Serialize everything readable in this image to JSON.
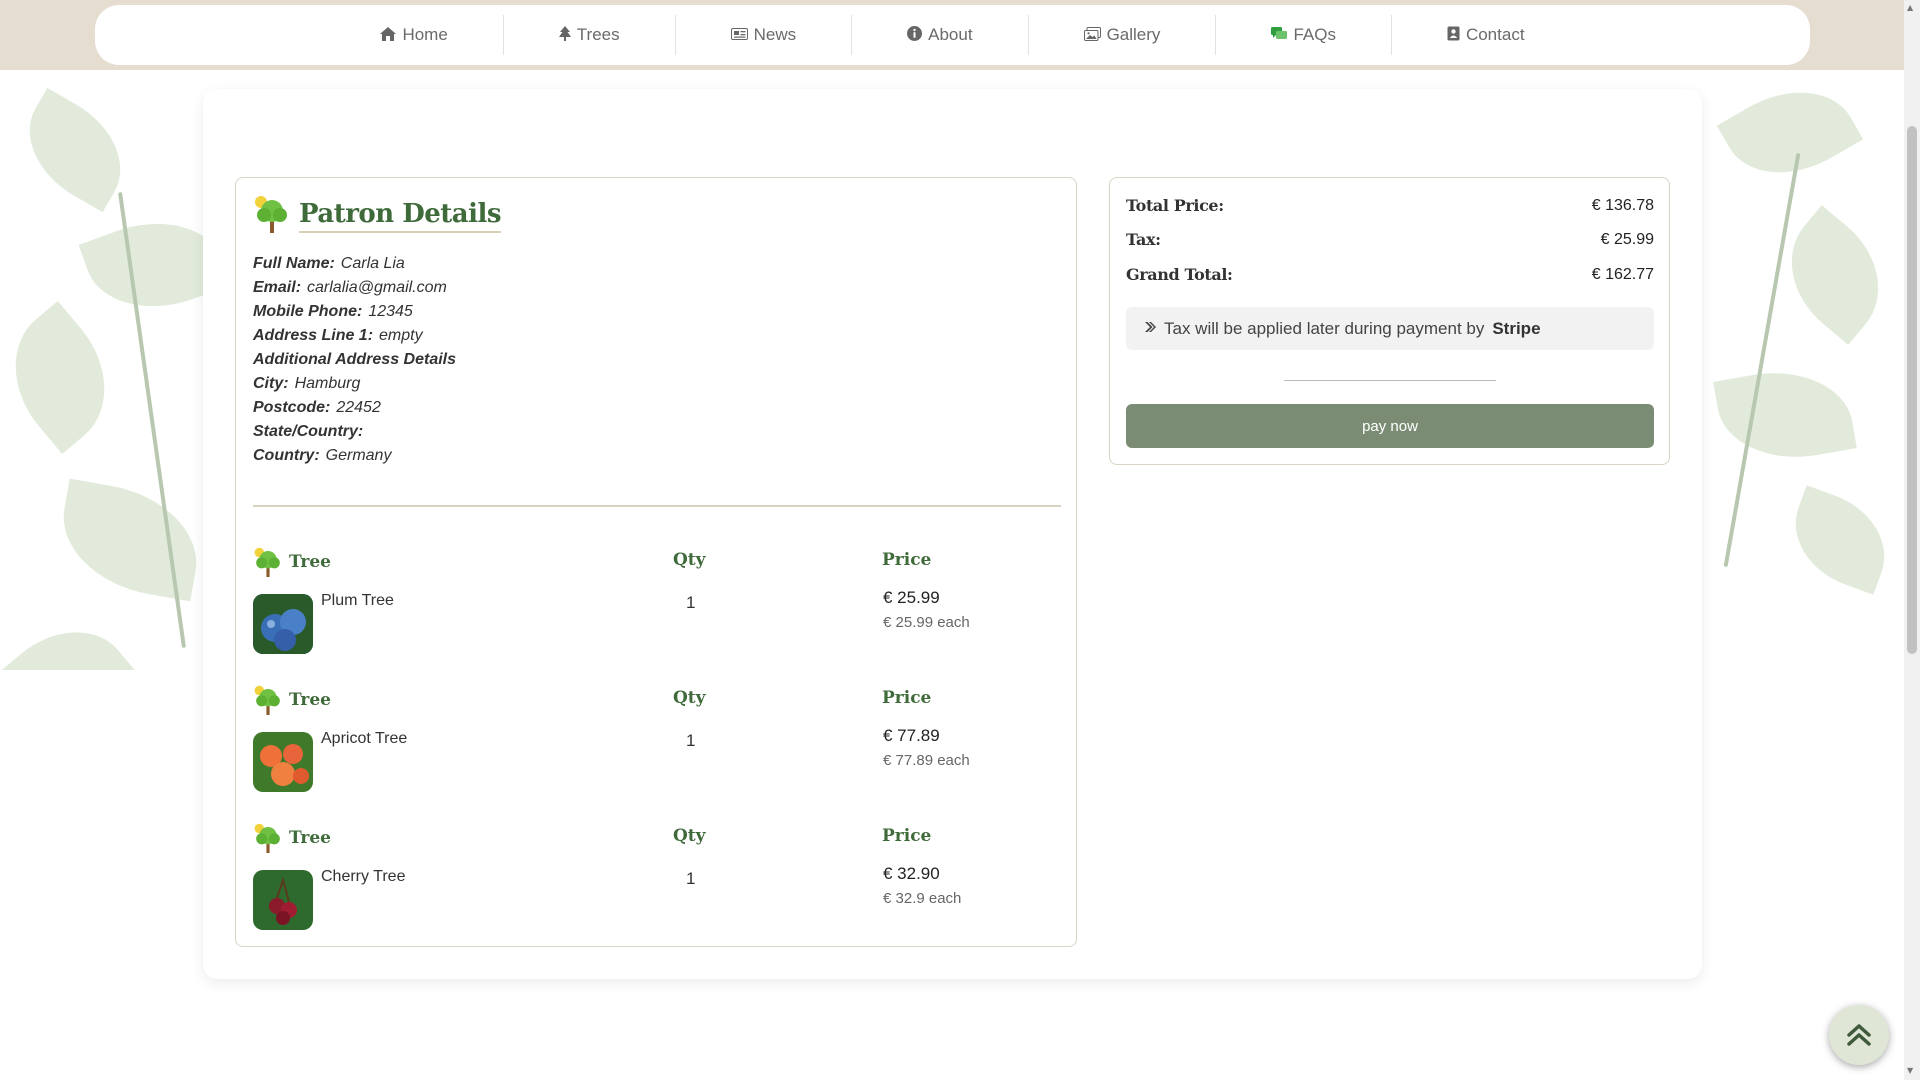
{
  "nav": {
    "items": [
      {
        "label": "Home",
        "icon": "home-icon"
      },
      {
        "label": "Trees",
        "icon": "tree-icon"
      },
      {
        "label": "News",
        "icon": "newspaper-icon"
      },
      {
        "label": "About",
        "icon": "info-icon"
      },
      {
        "label": "Gallery",
        "icon": "image-icon"
      },
      {
        "label": "FAQs",
        "icon": "chat-icon"
      },
      {
        "label": "Contact",
        "icon": "contact-card-icon"
      }
    ]
  },
  "patron": {
    "title": "Patron Details",
    "fields": [
      {
        "label": "Full Name:",
        "value": "Carla Lia"
      },
      {
        "label": "Email:",
        "value": "carlalia@gmail.com"
      },
      {
        "label": "Mobile Phone:",
        "value": "12345"
      },
      {
        "label": "Address Line 1:",
        "value": "empty"
      },
      {
        "label": "Additional Address Details",
        "value": ""
      },
      {
        "label": "City:",
        "value": "Hamburg"
      },
      {
        "label": "Postcode:",
        "value": "22452"
      },
      {
        "label": "State/Country:",
        "value": ""
      },
      {
        "label": "Country:",
        "value": "Germany"
      }
    ]
  },
  "items_header": {
    "tree": "Tree",
    "qty": "Qty",
    "price": "Price"
  },
  "items": [
    {
      "name": "Plum Tree",
      "qty": "1",
      "price": "€ 25.99",
      "each": "€ 25.99 each",
      "thumb_color": "#3a6fb8"
    },
    {
      "name": "Apricot Tree",
      "qty": "1",
      "price": "€ 77.89",
      "each": "€ 77.89 each",
      "thumb_color": "#e8643a"
    },
    {
      "name": "Cherry Tree",
      "qty": "1",
      "price": "€ 32.90",
      "each": "€ 32.9 each",
      "thumb_color": "#8b1a2a"
    }
  ],
  "summary": {
    "total_label": "Total Price:",
    "total_value": "€ 136.78",
    "tax_label": "Tax:",
    "tax_value": "€ 25.99",
    "grand_label": "Grand Total:",
    "grand_value": "€ 162.77",
    "tax_note_prefix": "Tax will be applied later during payment by",
    "tax_note_brand": "Stripe",
    "pay_label": "pay now"
  },
  "colors": {
    "accent_green": "#3f6a3a",
    "button_green": "#7a8d74",
    "band_beige": "#e4ddd0"
  }
}
